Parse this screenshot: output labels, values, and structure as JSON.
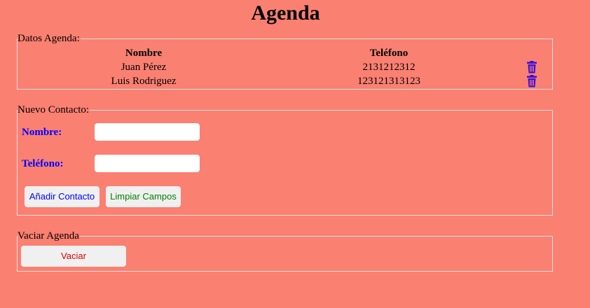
{
  "title": "Agenda",
  "datos": {
    "legend": "Datos Agenda:",
    "headers": {
      "nombre": "Nombre",
      "telefono": "Teléfono"
    },
    "rows": [
      {
        "nombre": "Juan Pérez",
        "telefono": "2131212312"
      },
      {
        "nombre": "Luis Rodriguez",
        "telefono": "123121313123"
      }
    ],
    "delete_icon": "trash-icon"
  },
  "nuevo": {
    "legend": "Nuevo Contacto:",
    "nombre_label": "Nombre:",
    "nombre_value": "",
    "telefono_label": "Teléfono:",
    "telefono_value": "",
    "add_label": "Añadir Contacto",
    "clear_label": "Limpiar Campos"
  },
  "vaciar": {
    "legend": "Vaciar Agenda",
    "button_label": "Vaciar"
  },
  "colors": {
    "background": "#fa8072",
    "label": "#0000ff",
    "icon": "#3b0ddb",
    "add_button_text": "#0000ff",
    "clear_button_text": "#008000",
    "vaciar_button_text": "#e00000"
  }
}
